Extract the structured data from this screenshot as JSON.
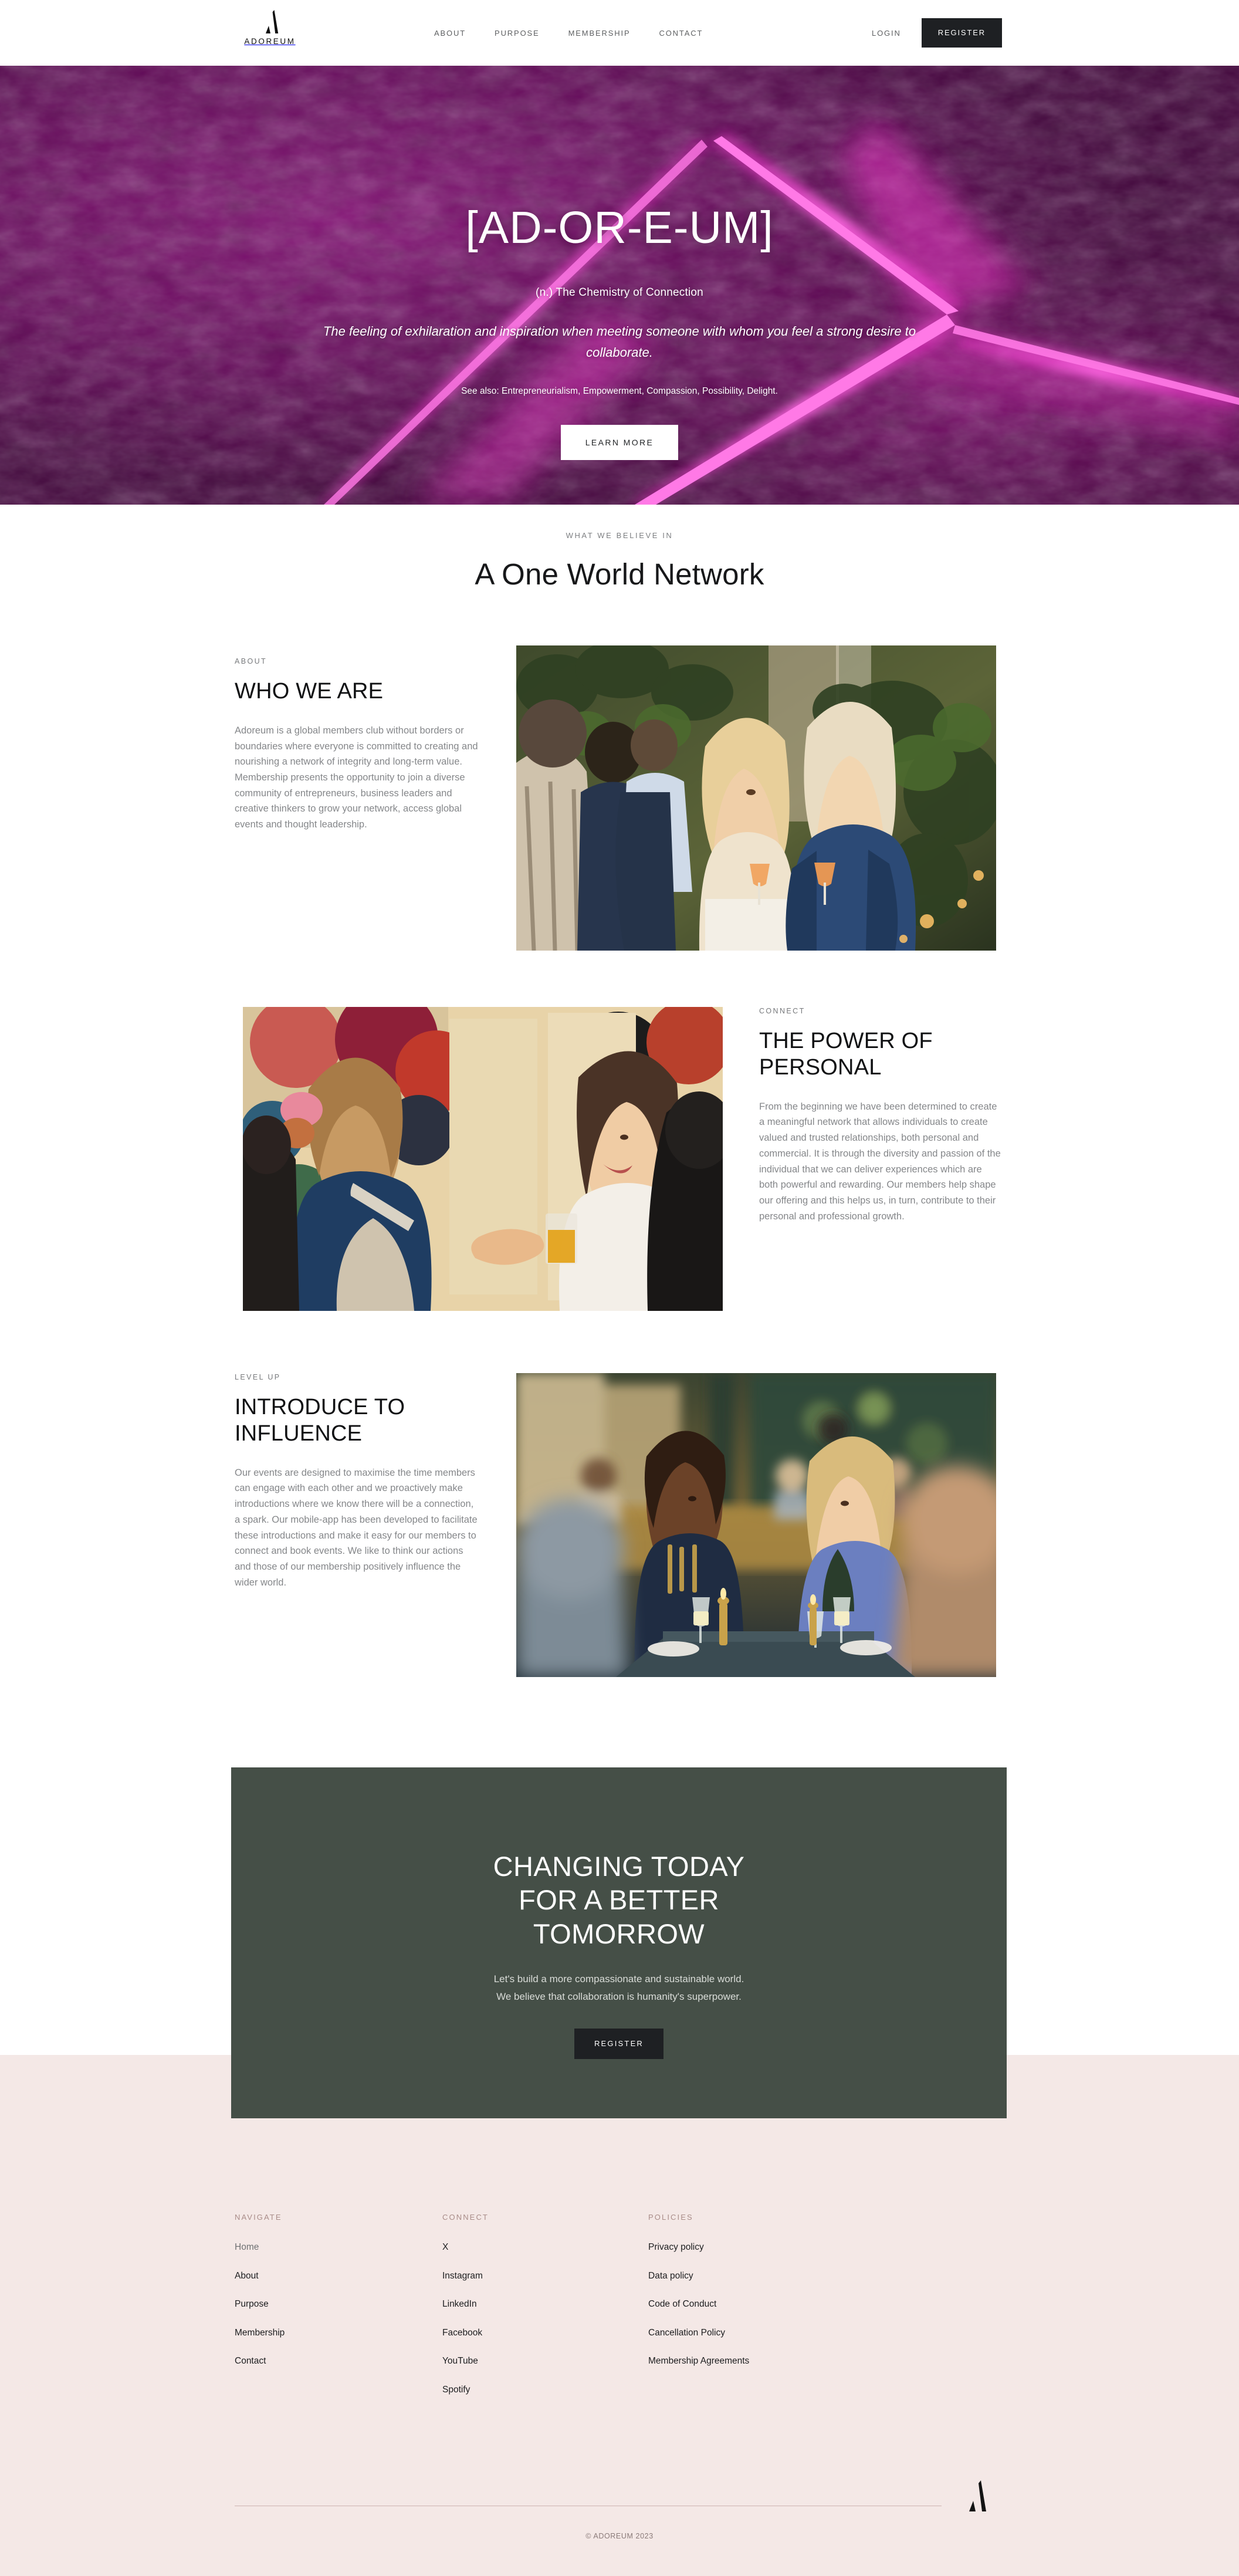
{
  "brand": {
    "name": "ADOREUM",
    "mark": "a-monogram-icon"
  },
  "header": {
    "nav": [
      {
        "label": "ABOUT"
      },
      {
        "label": "PURPOSE"
      },
      {
        "label": "MEMBERSHIP"
      },
      {
        "label": "CONTACT"
      }
    ],
    "login_label": "LOGIN",
    "register_label": "REGISTER"
  },
  "hero": {
    "title": "[AD-OR-E-UM]",
    "subtitle": "(n.) The Chemistry of Connection",
    "definition": "The feeling of exhilaration and inspiration when meeting someone with whom you feel a strong desire to collaborate.",
    "see_also": "See also: Entrepreneurialism, Empowerment, Compassion, Possibility, Delight.",
    "cta_label": "LEARN MORE",
    "colors": {
      "base": "#6d0f63",
      "neon": "#ff1ecd",
      "glow": "#ff4ddb"
    }
  },
  "believe": {
    "eyebrow": "WHAT WE BELIEVE IN",
    "title": "A One World Network"
  },
  "sections": [
    {
      "eyebrow": "ABOUT",
      "title": "WHO WE ARE",
      "body": "Adoreum is a global members club without borders or boundaries where everyone is committed to creating and nourishing a network of integrity and long-term value. Membership presents the opportunity to join a diverse community of entrepreneurs, business leaders and creative thinkers to grow your network, access global events and thought leadership.",
      "image_alt": "guests-mingling-with-drinks-amongst-greenery"
    },
    {
      "eyebrow": "CONNECT",
      "title": "THE POWER OF PERSONAL",
      "body": "From the beginning we have been determined to create a meaningful network that allows individuals to create valued and trusted relationships, both personal and commercial. It is through the diversity and passion of the individual that we can deliver experiences which are both powerful and rewarding. Our members help shape our offering and this helps us, in turn, contribute to their personal and professional growth.",
      "image_alt": "two-women-greeting-in-front-of-abstract-artwork"
    },
    {
      "eyebrow": "LEVEL UP",
      "title": "INTRODUCE TO INFLUENCE",
      "body": "Our events are designed to maximise the time members can engage with each other and we proactively make introductions where we know there will be a connection, a spark. Our mobile-app has been developed to facilitate these introductions and make it easy for our members to connect and book events. We like to think our actions and those of our membership positively influence the wider world.",
      "image_alt": "members-talking-at-formal-dinner-table"
    }
  ],
  "cta": {
    "title_lines": [
      "CHANGING TODAY",
      "FOR A BETTER",
      "TOMORROW"
    ],
    "sub_lines": [
      "Let's build a more compassionate and sustainable world.",
      "We believe that collaboration is humanity's superpower."
    ],
    "button_label": "REGISTER",
    "background": "#454f47"
  },
  "footer": {
    "background": "#f4e8e6",
    "columns": [
      {
        "heading": "NAVIGATE",
        "links": [
          "Home",
          "About",
          "Purpose",
          "Membership",
          "Contact"
        ]
      },
      {
        "heading": "CONNECT",
        "links": [
          "X",
          "Instagram",
          "LinkedIn",
          "Facebook",
          "YouTube",
          "Spotify"
        ]
      },
      {
        "heading": "POLICIES",
        "links": [
          "Privacy policy",
          "Data policy",
          "Code of Conduct",
          "Cancellation Policy",
          "Membership Agreements"
        ]
      }
    ],
    "copyright": "© ADOREUM 2023"
  }
}
